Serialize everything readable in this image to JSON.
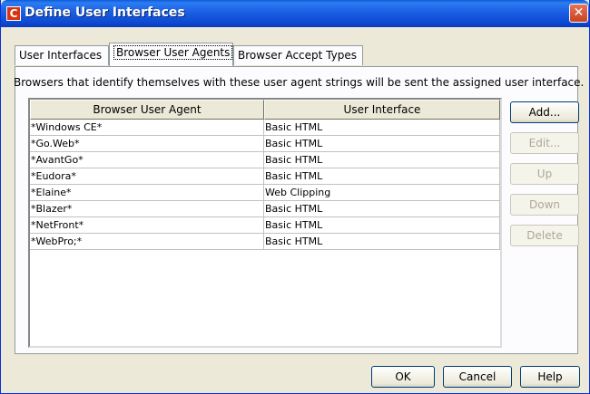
{
  "window": {
    "title": "Define User Interfaces",
    "app_icon_letter": "C",
    "close_glyph": "✕"
  },
  "tabs": [
    {
      "label": "User Interfaces",
      "active": false
    },
    {
      "label": "Browser User Agents",
      "active": true
    },
    {
      "label": "Browser Accept Types",
      "active": false
    }
  ],
  "description": "Browsers that identify themselves with these user agent strings will be sent the assigned user interface.",
  "table": {
    "columns": [
      "Browser User Agent",
      "User Interface"
    ],
    "rows": [
      {
        "agent": "*Windows CE*",
        "ui": "Basic HTML"
      },
      {
        "agent": "*Go.Web*",
        "ui": "Basic HTML"
      },
      {
        "agent": "*AvantGo*",
        "ui": "Basic HTML"
      },
      {
        "agent": "*Eudora*",
        "ui": "Basic HTML"
      },
      {
        "agent": "*Elaine*",
        "ui": "Web Clipping"
      },
      {
        "agent": "*Blazer*",
        "ui": "Basic HTML"
      },
      {
        "agent": "*NetFront*",
        "ui": "Basic HTML"
      },
      {
        "agent": "*WebPro;*",
        "ui": "Basic HTML"
      }
    ]
  },
  "side_buttons": {
    "add": "Add...",
    "edit": "Edit...",
    "up": "Up",
    "down": "Down",
    "delete": "Delete"
  },
  "footer_buttons": {
    "ok": "OK",
    "cancel": "Cancel",
    "help": "Help"
  }
}
